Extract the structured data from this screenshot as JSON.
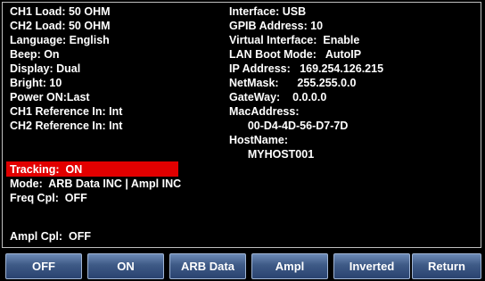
{
  "left_column": [
    "CH1 Load: 50 OHM",
    "CH2 Load: 50 OHM",
    "Language: English",
    "Beep: On",
    "Display: Dual",
    "Bright: 10",
    "Power ON:Last",
    "CH1 Reference In: Int",
    "CH2 Reference In: Int",
    "Tracking:  ON",
    "Mode:  ARB Data INC | Ampl INC",
    "Freq Cpl:  OFF",
    "",
    "Ampl Cpl:  OFF"
  ],
  "right_column": [
    "Interface: USB",
    "GPIB Address: 10",
    "Virtual Interface:  Enable",
    "LAN Boot Mode:   AutoIP",
    "IP Address:   169.254.126.215",
    "NetMask:      255.255.0.0",
    "GateWay:    0.0.0.0",
    "MacAddress:",
    "      00-D4-4D-56-D7-7D",
    "HostName:",
    "      MYHOST001"
  ],
  "highlight_color": "#e20000",
  "softkeys": [
    "OFF",
    "ON",
    "ARB Data",
    "Ampl",
    "Inverted",
    "Return"
  ]
}
